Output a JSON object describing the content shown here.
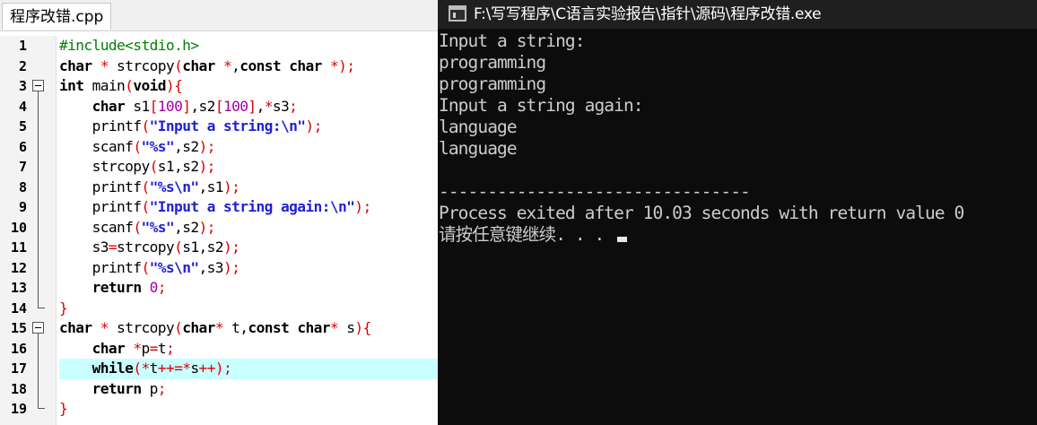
{
  "editor": {
    "tab_title": "程序改错.cpp",
    "highlighted_line": 17,
    "lines": [
      {
        "num": "1",
        "fold": "",
        "tokens": [
          [
            "pp",
            "#include<stdio.h>"
          ]
        ]
      },
      {
        "num": "2",
        "fold": "",
        "tokens": [
          [
            "kw",
            "char"
          ],
          [
            "plain",
            " "
          ],
          [
            "op",
            "*"
          ],
          [
            "plain",
            " strcopy"
          ],
          [
            "op",
            "("
          ],
          [
            "kw",
            "char"
          ],
          [
            "plain",
            " "
          ],
          [
            "op",
            "*"
          ],
          [
            "plain",
            ","
          ],
          [
            "kw",
            "const"
          ],
          [
            "plain",
            " "
          ],
          [
            "kw",
            "char"
          ],
          [
            "plain",
            " "
          ],
          [
            "op",
            "*"
          ],
          [
            "op",
            ")"
          ],
          [
            "op",
            ";"
          ]
        ]
      },
      {
        "num": "3",
        "fold": "open",
        "tokens": [
          [
            "kw",
            "int"
          ],
          [
            "plain",
            " main"
          ],
          [
            "op",
            "("
          ],
          [
            "kw",
            "void"
          ],
          [
            "op",
            ")"
          ],
          [
            "op",
            "{"
          ]
        ]
      },
      {
        "num": "4",
        "fold": "bar",
        "tokens": [
          [
            "plain",
            "    "
          ],
          [
            "kw",
            "char"
          ],
          [
            "plain",
            " s1"
          ],
          [
            "op",
            "["
          ],
          [
            "num",
            "100"
          ],
          [
            "op",
            "]"
          ],
          [
            "plain",
            ",s2"
          ],
          [
            "op",
            "["
          ],
          [
            "num",
            "100"
          ],
          [
            "op",
            "]"
          ],
          [
            "plain",
            ","
          ],
          [
            "op",
            "*"
          ],
          [
            "plain",
            "s3"
          ],
          [
            "op",
            ";"
          ]
        ]
      },
      {
        "num": "5",
        "fold": "bar",
        "tokens": [
          [
            "plain",
            "    printf"
          ],
          [
            "op",
            "("
          ],
          [
            "str",
            "\"Input a string:\\n\""
          ],
          [
            "op",
            ")"
          ],
          [
            "op",
            ";"
          ]
        ]
      },
      {
        "num": "6",
        "fold": "bar",
        "tokens": [
          [
            "plain",
            "    scanf"
          ],
          [
            "op",
            "("
          ],
          [
            "str",
            "\"%s\""
          ],
          [
            "plain",
            ",s2"
          ],
          [
            "op",
            ")"
          ],
          [
            "op",
            ";"
          ]
        ]
      },
      {
        "num": "7",
        "fold": "bar",
        "tokens": [
          [
            "plain",
            "    strcopy"
          ],
          [
            "op",
            "("
          ],
          [
            "plain",
            "s1,s2"
          ],
          [
            "op",
            ")"
          ],
          [
            "op",
            ";"
          ]
        ]
      },
      {
        "num": "8",
        "fold": "bar",
        "tokens": [
          [
            "plain",
            "    printf"
          ],
          [
            "op",
            "("
          ],
          [
            "str",
            "\"%s\\n\""
          ],
          [
            "plain",
            ",s1"
          ],
          [
            "op",
            ")"
          ],
          [
            "op",
            ";"
          ]
        ]
      },
      {
        "num": "9",
        "fold": "bar",
        "tokens": [
          [
            "plain",
            "    printf"
          ],
          [
            "op",
            "("
          ],
          [
            "str",
            "\"Input a string again:\\n\""
          ],
          [
            "op",
            ")"
          ],
          [
            "op",
            ";"
          ]
        ]
      },
      {
        "num": "10",
        "fold": "bar",
        "tokens": [
          [
            "plain",
            "    scanf"
          ],
          [
            "op",
            "("
          ],
          [
            "str",
            "\"%s\""
          ],
          [
            "plain",
            ",s2"
          ],
          [
            "op",
            ")"
          ],
          [
            "op",
            ";"
          ]
        ]
      },
      {
        "num": "11",
        "fold": "bar",
        "tokens": [
          [
            "plain",
            "    s3"
          ],
          [
            "op",
            "="
          ],
          [
            "plain",
            "strcopy"
          ],
          [
            "op",
            "("
          ],
          [
            "plain",
            "s1,s2"
          ],
          [
            "op",
            ")"
          ],
          [
            "op",
            ";"
          ]
        ]
      },
      {
        "num": "12",
        "fold": "bar",
        "tokens": [
          [
            "plain",
            "    printf"
          ],
          [
            "op",
            "("
          ],
          [
            "str",
            "\"%s\\n\""
          ],
          [
            "plain",
            ",s3"
          ],
          [
            "op",
            ")"
          ],
          [
            "op",
            ";"
          ]
        ]
      },
      {
        "num": "13",
        "fold": "bar",
        "tokens": [
          [
            "plain",
            "    "
          ],
          [
            "kw",
            "return"
          ],
          [
            "plain",
            " "
          ],
          [
            "num",
            "0"
          ],
          [
            "op",
            ";"
          ]
        ]
      },
      {
        "num": "14",
        "fold": "end",
        "tokens": [
          [
            "op",
            "}"
          ]
        ]
      },
      {
        "num": "15",
        "fold": "open",
        "tokens": [
          [
            "kw",
            "char"
          ],
          [
            "plain",
            " "
          ],
          [
            "op",
            "*"
          ],
          [
            "plain",
            " strcopy"
          ],
          [
            "op",
            "("
          ],
          [
            "kw",
            "char"
          ],
          [
            "op",
            "*"
          ],
          [
            "plain",
            " t,"
          ],
          [
            "kw",
            "const"
          ],
          [
            "plain",
            " "
          ],
          [
            "kw",
            "char"
          ],
          [
            "op",
            "*"
          ],
          [
            "plain",
            " s"
          ],
          [
            "op",
            ")"
          ],
          [
            "op",
            "{"
          ]
        ]
      },
      {
        "num": "16",
        "fold": "bar",
        "tokens": [
          [
            "plain",
            "    "
          ],
          [
            "kw",
            "char"
          ],
          [
            "plain",
            " "
          ],
          [
            "op",
            "*"
          ],
          [
            "plain",
            "p"
          ],
          [
            "op",
            "="
          ],
          [
            "plain",
            "t"
          ],
          [
            "op",
            ";"
          ]
        ]
      },
      {
        "num": "17",
        "fold": "bar",
        "tokens": [
          [
            "plain",
            "    "
          ],
          [
            "kw",
            "while"
          ],
          [
            "op",
            "("
          ],
          [
            "op",
            "*"
          ],
          [
            "plain",
            "t"
          ],
          [
            "op",
            "++="
          ],
          [
            "op",
            "*"
          ],
          [
            "plain",
            "s"
          ],
          [
            "op",
            "++"
          ],
          [
            "op",
            ")"
          ],
          [
            "op",
            ";"
          ]
        ]
      },
      {
        "num": "18",
        "fold": "bar",
        "tokens": [
          [
            "plain",
            "    "
          ],
          [
            "kw",
            "return"
          ],
          [
            "plain",
            " p"
          ],
          [
            "op",
            ";"
          ]
        ]
      },
      {
        "num": "19",
        "fold": "end",
        "tokens": [
          [
            "op",
            "}"
          ]
        ]
      }
    ]
  },
  "console": {
    "title": "F:\\写写程序\\C语言实验报告\\指针\\源码\\程序改错.exe",
    "lines": [
      "Input a string:",
      "programming",
      "programming",
      "Input a string again:",
      "language",
      "language",
      "",
      "--------------------------------",
      "Process exited after 10.03 seconds with return value 0",
      "请按任意键继续. . . "
    ]
  },
  "colors": {
    "keyword": "#000000",
    "string": "#1f1fd6",
    "number": "#a000a0",
    "preprocessor": "#008000",
    "operator": "#e00000",
    "highlight": "#c8ffff",
    "console_bg": "#0c0c0c",
    "console_text": "#cccccc"
  }
}
